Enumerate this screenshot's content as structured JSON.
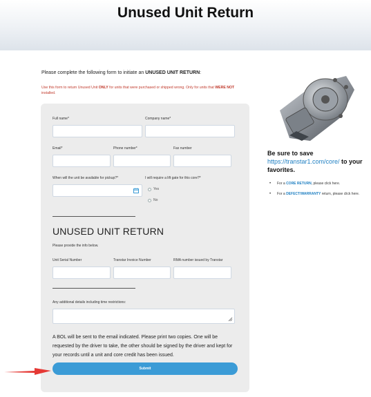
{
  "header": {
    "title": "Unused Unit Return"
  },
  "intro": {
    "prefix": "Please complete the following form to initiate an ",
    "bold": "UNUSED UNIT RETURN",
    "suffix": ":"
  },
  "warning": {
    "part1": "Use this form to return Unused Unit ",
    "only": "ONLY",
    "part2": " for units that were purchased or shipped wrong. Only for units that ",
    "were_not": "WERE NOT",
    "part3": " installed."
  },
  "form": {
    "full_name_label": "Full name*",
    "company_name_label": "Company name*",
    "email_label": "Email*",
    "phone_label": "Phone number*",
    "fax_label": "Fax number",
    "pickup_label": "When will the unit be available for pickup?*",
    "liftgate_label": "I will require a lift gate for this core?*",
    "liftgate_options": [
      "Yes",
      "No"
    ],
    "section_title": "UNUSED UNIT RETURN",
    "section_subtitle": "Please provide the info below.",
    "serial_label": "Unit Serial Number",
    "invoice_label": "Transtar Invoice Number",
    "rma_label": "RMA number issued by Transtar",
    "details_label": "Any additional details including time restrictions:",
    "bol_text": "A BOL will be sent to the email indicated. Please print two copies. One will be requested by the driver to take, the other should be signed by the driver and kept for your records until a unit and core credit has been issued.",
    "submit_label": "Submit"
  },
  "sidebar": {
    "title_prefix": "Be sure to save ",
    "url": "https://transtar1.com/core/",
    "title_suffix": " to your favorites.",
    "bullets": [
      {
        "prefix": "For a ",
        "link": "CORE RETURN",
        "suffix": ", please click here."
      },
      {
        "prefix": "For a ",
        "link": "DEFECT/WARRANTY",
        "suffix": " return, please click here."
      }
    ]
  },
  "colors": {
    "accent": "#3b9bd6",
    "warning": "#c0392b",
    "arrow": "#e53935"
  }
}
